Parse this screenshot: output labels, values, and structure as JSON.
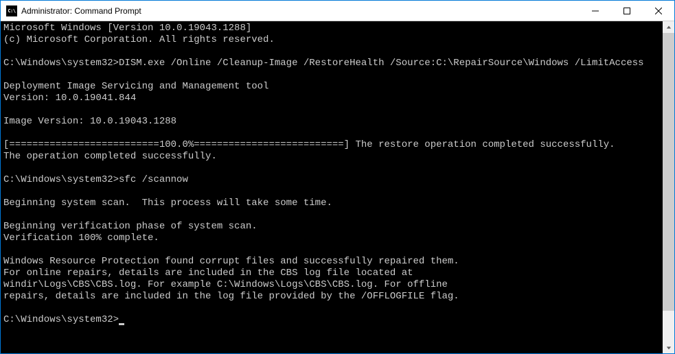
{
  "titlebar": {
    "icon_text": "C:\\",
    "title": "Administrator: Command Prompt"
  },
  "console": {
    "line1": "Microsoft Windows [Version 10.0.19043.1288]",
    "line2": "(c) Microsoft Corporation. All rights reserved.",
    "blank1": "",
    "prompt1_path": "C:\\Windows\\system32>",
    "prompt1_cmd": "DISM.exe /Online /Cleanup-Image /RestoreHealth /Source:C:\\RepairSource\\Windows /LimitAccess",
    "blank2": "",
    "dism1": "Deployment Image Servicing and Management tool",
    "dism2": "Version: 10.0.19041.844",
    "blank3": "",
    "imgver": "Image Version: 10.0.19043.1288",
    "blank4": "",
    "progress": "[==========================100.0%==========================] The restore operation completed successfully.",
    "opcomplete": "The operation completed successfully.",
    "blank5": "",
    "prompt2_path": "C:\\Windows\\system32>",
    "prompt2_cmd": "sfc /scannow",
    "blank6": "",
    "scan1": "Beginning system scan.  This process will take some time.",
    "blank7": "",
    "scan2": "Beginning verification phase of system scan.",
    "scan3": "Verification 100% complete.",
    "blank8": "",
    "wrp1": "Windows Resource Protection found corrupt files and successfully repaired them.",
    "wrp2": "For online repairs, details are included in the CBS log file located at",
    "wrp3": "windir\\Logs\\CBS\\CBS.log. For example C:\\Windows\\Logs\\CBS\\CBS.log. For offline",
    "wrp4": "repairs, details are included in the log file provided by the /OFFLOGFILE flag.",
    "blank9": "",
    "prompt3_path": "C:\\Windows\\system32>"
  }
}
